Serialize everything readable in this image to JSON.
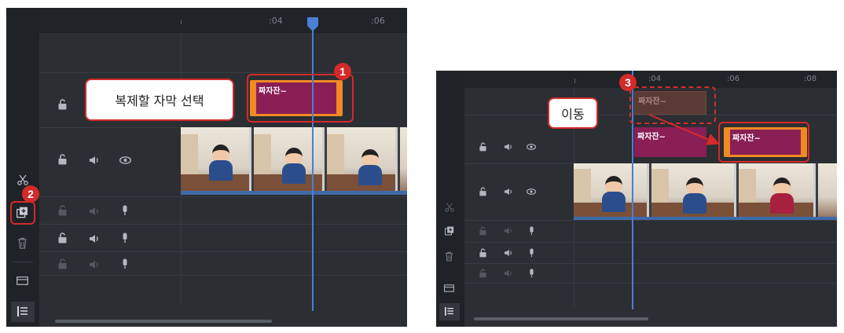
{
  "panel1": {
    "ruler_ticks": [
      ":04",
      ":06"
    ],
    "title_clip_text": "짜자잔~",
    "callout_text": "복제할 자막 선택",
    "badge_1": "1",
    "badge_2": "2"
  },
  "panel2": {
    "ruler_ticks": [
      ":04",
      ":06",
      ":08"
    ],
    "ghost_clip_text": "짜자잔~",
    "original_clip_text": "짜자잔~",
    "moved_clip_text": "짜자잔~",
    "callout_text": "이동",
    "badge_3": "3"
  },
  "colors": {
    "accent_highlight": "#d42a2a",
    "title_clip_border": "#f08a22",
    "title_clip_fill": "#8a1f56",
    "playhead": "#4a7fd4",
    "timeline_bg": "#2b2e33"
  },
  "icons": {
    "lock": "lock-open-icon",
    "audio": "speaker-icon",
    "visibility": "eye-icon",
    "mic": "microphone-icon",
    "cut": "scissors-icon",
    "duplicate": "duplicate-icon",
    "delete": "trash-icon",
    "media": "media-box-icon",
    "tracks": "tracks-menu-icon"
  }
}
